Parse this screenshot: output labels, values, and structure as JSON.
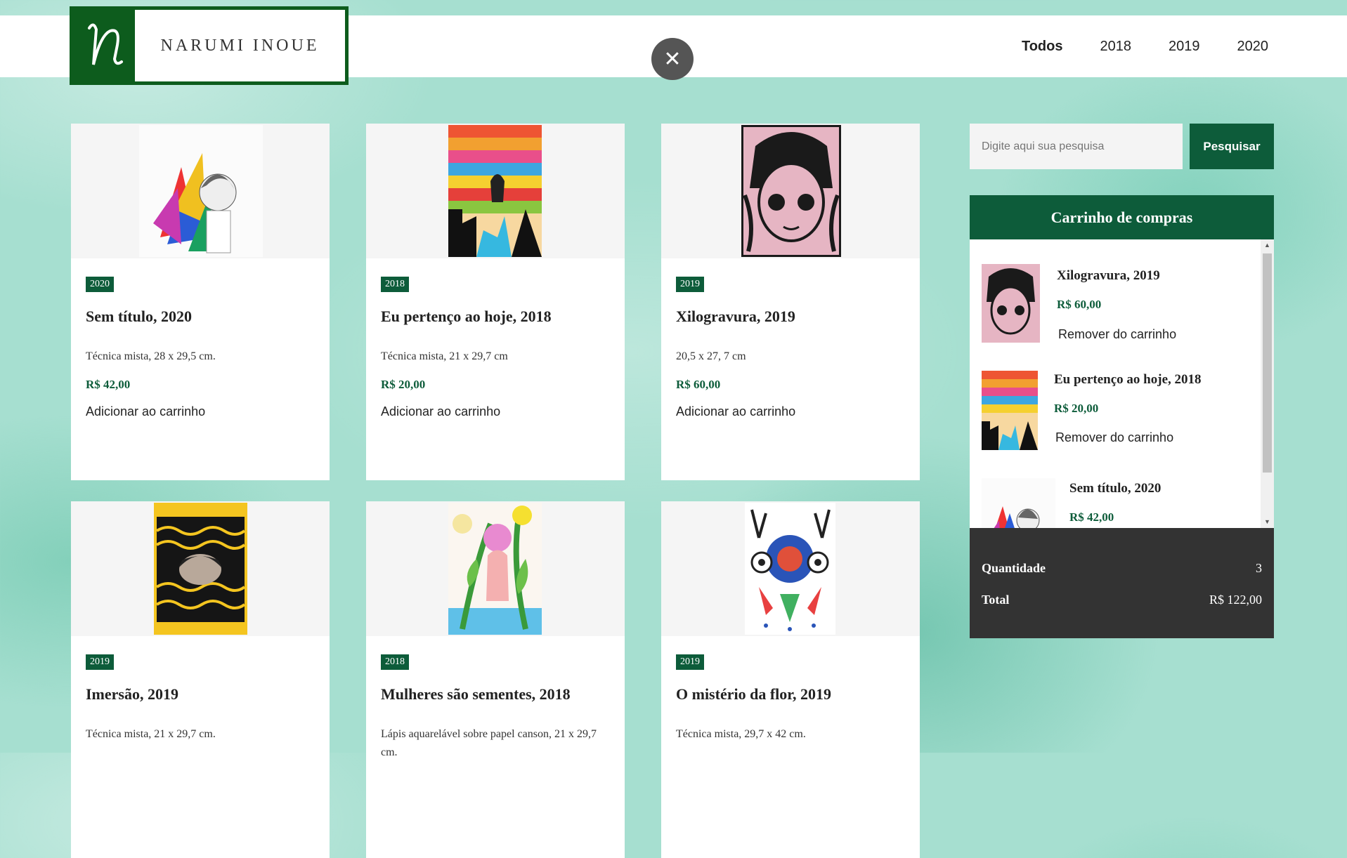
{
  "header": {
    "logo_text": "NARUMI INOUE",
    "nav": [
      "Todos",
      "2018",
      "2019",
      "2020"
    ]
  },
  "products": [
    {
      "year": "2020",
      "title": "Sem título, 2020",
      "desc": "Técnica mista, 28 x 29,5 cm.",
      "price": "R$ 42,00",
      "action": "Adicionar ao carrinho"
    },
    {
      "year": "2018",
      "title": "Eu pertenço ao hoje, 2018",
      "desc": "Técnica mista, 21 x 29,7 cm",
      "price": "R$ 20,00",
      "action": "Adicionar ao carrinho"
    },
    {
      "year": "2019",
      "title": "Xilogravura, 2019",
      "desc": "20,5 x 27, 7 cm",
      "price": "R$ 60,00",
      "action": "Adicionar ao carrinho"
    },
    {
      "year": "2019",
      "title": "Imersão, 2019",
      "desc": "Técnica mista, 21 x 29,7 cm."
    },
    {
      "year": "2018",
      "title": "Mulheres são sementes, 2018",
      "desc": "Lápis aquarelável sobre papel canson, 21 x 29,7 cm."
    },
    {
      "year": "2019",
      "title": "O mistério da flor, 2019",
      "desc": "Técnica mista, 29,7 x 42 cm."
    }
  ],
  "search": {
    "placeholder": "Digite aqui sua pesquisa",
    "button": "Pesquisar"
  },
  "cart": {
    "title": "Carrinho de compras",
    "items": [
      {
        "title": "Xilogravura, 2019",
        "price": "R$ 60,00",
        "remove": "Remover do carrinho"
      },
      {
        "title": "Eu pertenço ao hoje, 2018",
        "price": "R$ 20,00",
        "remove": "Remover do carrinho"
      },
      {
        "title": "Sem título, 2020",
        "price": "R$ 42,00"
      }
    ],
    "quantity_label": "Quantidade",
    "quantity": "3",
    "total_label": "Total",
    "total": "R$ 122,00"
  },
  "colors": {
    "accent": "#0d5c3a",
    "logo_green": "#0d5c1d",
    "summary_bg": "#333333"
  }
}
